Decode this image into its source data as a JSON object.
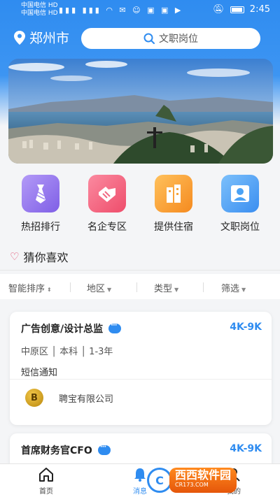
{
  "status_bar": {
    "carrier1": "中国电信 HD",
    "carrier2": "中国电信 HD",
    "time": "2:45"
  },
  "header": {
    "city": "郑州市",
    "search_placeholder": "文职岗位"
  },
  "categories": [
    {
      "label": "热招排行",
      "icon": "tie-icon",
      "color": "#9b7cf0"
    },
    {
      "label": "名企专区",
      "icon": "handshake-icon",
      "color": "#f0627a"
    },
    {
      "label": "提供住宿",
      "icon": "building-icon",
      "color": "#f7a43a"
    },
    {
      "label": "文职岗位",
      "icon": "person-card-icon",
      "color": "#4aa2f5"
    }
  ],
  "guess": {
    "title": "猜你喜欢"
  },
  "filters": [
    {
      "label": "智能排序"
    },
    {
      "label": "地区"
    },
    {
      "label": "类型"
    },
    {
      "label": "筛选"
    }
  ],
  "jobs": [
    {
      "title": "广告创意/设计总监",
      "salary": "4K-9K",
      "tags": "中原区  │ 本科  │ 1-3年",
      "notice": "短信通知",
      "company": "聘宝有限公司",
      "company_logo_letter": "B"
    },
    {
      "title": "首席财务官CFO",
      "salary": "4K-9K"
    }
  ],
  "tabbar": {
    "items": [
      {
        "label": "首页",
        "icon": "home-icon"
      },
      {
        "label": "消息",
        "icon": "bell-icon"
      },
      {
        "label": "我的",
        "icon": "user-icon"
      }
    ]
  },
  "watermark": {
    "text": "西西软件园",
    "sub": "CR173.COM"
  },
  "colors": {
    "accent": "#2f8cf0"
  }
}
